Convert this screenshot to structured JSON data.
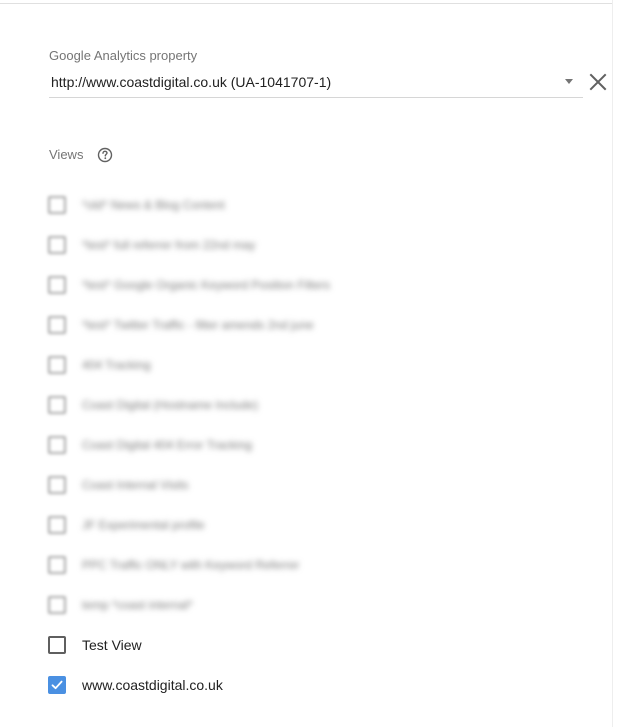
{
  "property": {
    "label": "Google Analytics property",
    "selected": "http://www.coastdigital.co.uk (UA-1041707-1)"
  },
  "views": {
    "label": "Views",
    "items": [
      {
        "label": "*old* News & Blog Content",
        "checked": false,
        "blurred": true
      },
      {
        "label": "*test* full referrer from 22nd may",
        "checked": false,
        "blurred": true
      },
      {
        "label": "*test* Google Organic Keyword Position Filters",
        "checked": false,
        "blurred": true
      },
      {
        "label": "*test* Twitter Traffic - filter amends 2nd june",
        "checked": false,
        "blurred": true
      },
      {
        "label": "404 Tracking",
        "checked": false,
        "blurred": true
      },
      {
        "label": "Coast Digital (Hostname Include)",
        "checked": false,
        "blurred": true
      },
      {
        "label": "Coast Digital 404 Error Tracking",
        "checked": false,
        "blurred": true
      },
      {
        "label": "Coast Internal Visits",
        "checked": false,
        "blurred": true
      },
      {
        "label": "JF Experimental profile",
        "checked": false,
        "blurred": true
      },
      {
        "label": "PPC Traffic ONLY with Keyword Referrer",
        "checked": false,
        "blurred": true
      },
      {
        "label": "temp *coast internal*",
        "checked": false,
        "blurred": true
      },
      {
        "label": "Test View",
        "checked": false,
        "blurred": false
      },
      {
        "label": "www.coastdigital.co.uk",
        "checked": true,
        "blurred": false
      }
    ]
  },
  "icons": {
    "clear": "close-icon",
    "help": "help-circle-icon",
    "dropdown": "dropdown-arrow-icon",
    "check": "checkmark-icon"
  },
  "colors": {
    "accent": "#4a90e2",
    "label": "#757575",
    "text": "#212121"
  }
}
